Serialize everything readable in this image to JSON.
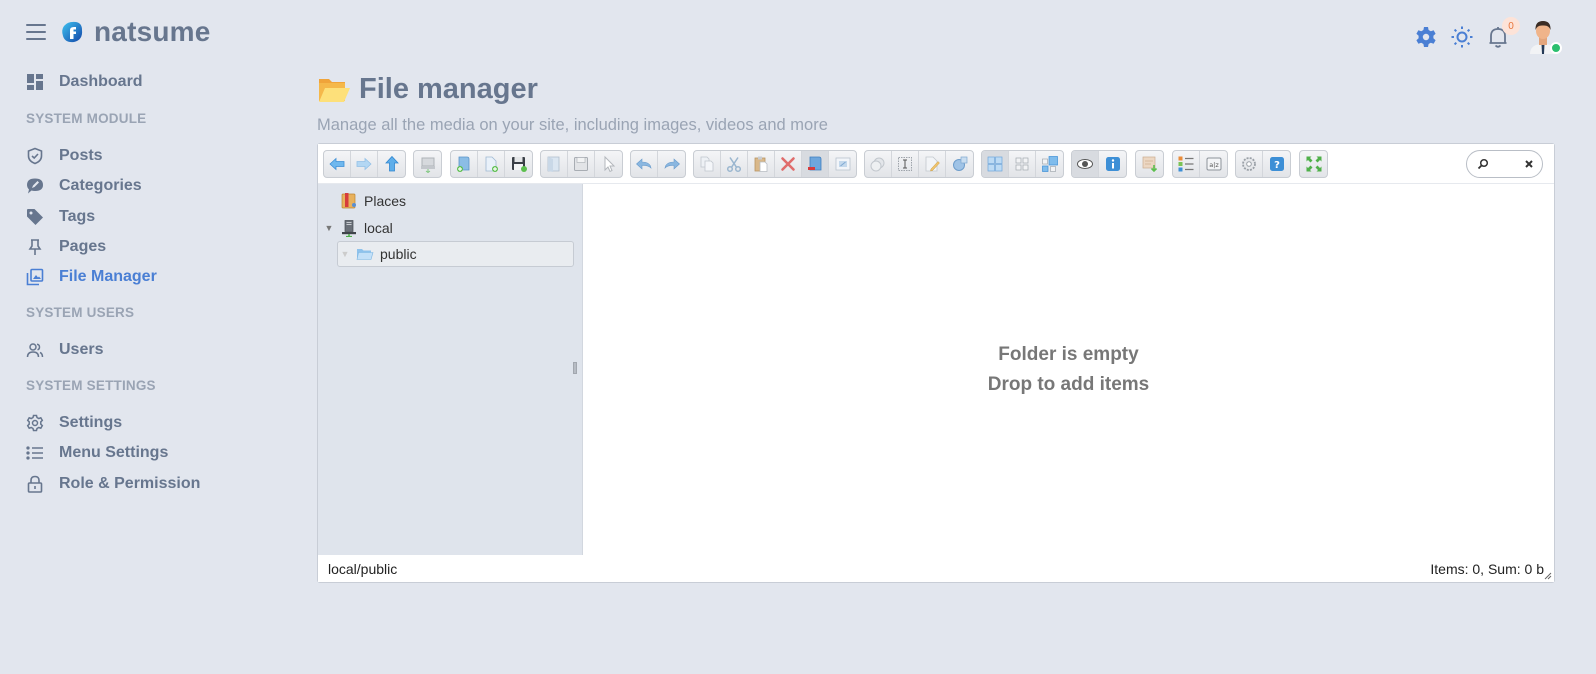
{
  "app": {
    "brand_name": "natsume"
  },
  "sidebar": {
    "items": [
      {
        "label": "Dashboard",
        "icon": "dashboard-icon"
      },
      {
        "label": "Posts",
        "icon": "shield-check-icon"
      },
      {
        "label": "Categories",
        "icon": "chat-pencil-icon"
      },
      {
        "label": "Tags",
        "icon": "tag-icon"
      },
      {
        "label": "Pages",
        "icon": "pin-icon"
      },
      {
        "label": "File Manager",
        "icon": "images-icon",
        "active": true
      },
      {
        "label": "Users",
        "icon": "users-icon"
      },
      {
        "label": "Settings",
        "icon": "gear-icon"
      },
      {
        "label": "Menu Settings",
        "icon": "list-icon"
      },
      {
        "label": "Role & Permission",
        "icon": "lock-icon"
      }
    ],
    "sections": {
      "module": "SYSTEM MODULE",
      "users": "SYSTEM USERS",
      "settings": "SYSTEM SETTINGS"
    }
  },
  "topbar": {
    "notification_count": "0",
    "accent_color": "#4a7fd4"
  },
  "page": {
    "title": "File manager",
    "subtitle": "Manage all the media on your site, including images, videos and more"
  },
  "file_manager": {
    "toolbar_groups": [
      [
        "back",
        "forward",
        "up"
      ],
      [
        "mount"
      ],
      [
        "new-folder",
        "new-file",
        "upload"
      ],
      [
        "open",
        "save",
        "select"
      ],
      [
        "undo",
        "redo"
      ],
      [
        "copy",
        "cut",
        "paste",
        "delete",
        "empty",
        "resize"
      ],
      [
        "duplicate",
        "rename",
        "edit",
        "extract"
      ],
      [
        "view-icons-large",
        "view-icons-small",
        "view-mixed"
      ],
      [
        "preview",
        "info"
      ],
      [
        "archive"
      ],
      [
        "view-list",
        "sort"
      ],
      [
        "preferences",
        "help"
      ],
      [
        "fullscreen"
      ]
    ],
    "search": {
      "placeholder": ""
    },
    "tree": [
      {
        "label": "Places",
        "icon": "places-icon"
      },
      {
        "label": "local",
        "icon": "drive-icon",
        "expanded": true
      },
      {
        "label": "public",
        "icon": "folder-icon",
        "selected": true
      }
    ],
    "empty_message": "Folder is empty",
    "empty_hint": "Drop to add items",
    "status_path": "local/public",
    "status_summary": "Items: 0, Sum: 0 b"
  }
}
